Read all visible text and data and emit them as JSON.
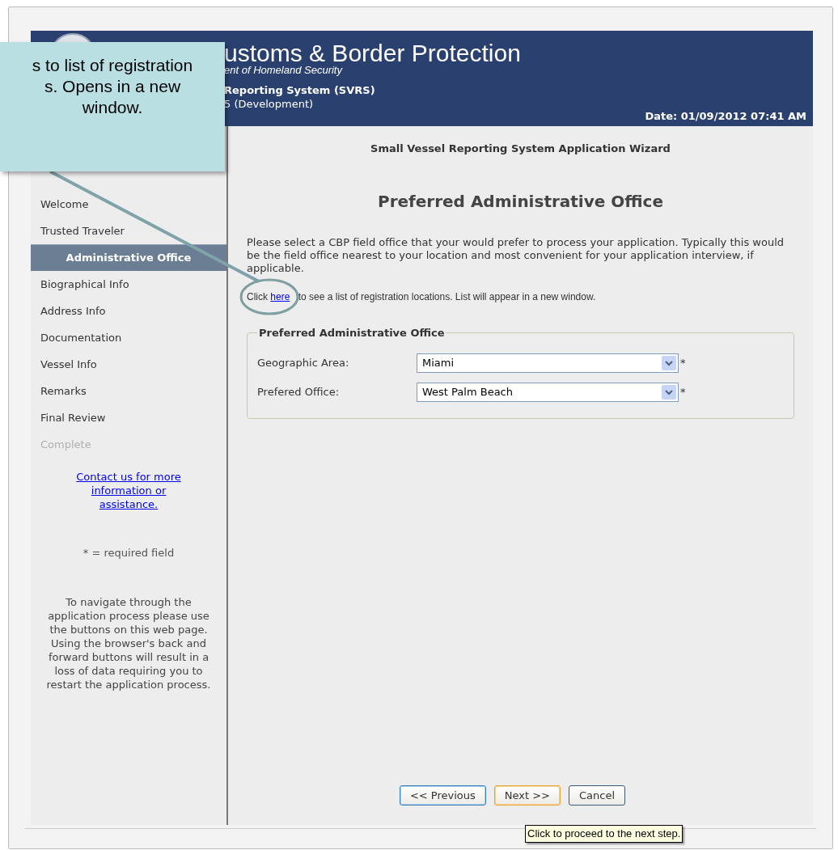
{
  "header": {
    "title": "ustoms & Border Protection",
    "subtitle": "ent of Homeland Security",
    "system": "Reporting System (SVRS)",
    "version": "5 (Development)",
    "date": "Date: 01/09/2012 07:41 AM"
  },
  "callout": {
    "lines": [
      "s to list of registration",
      "s. Opens in a new",
      "window."
    ]
  },
  "sidebar": {
    "steps": [
      {
        "label": "Welcome",
        "selected": false,
        "disabled": false
      },
      {
        "label": "Trusted Traveler",
        "selected": false,
        "disabled": false
      },
      {
        "label": "Administrative Office",
        "selected": true,
        "disabled": false
      },
      {
        "label": "Biographical Info",
        "selected": false,
        "disabled": false
      },
      {
        "label": "Address Info",
        "selected": false,
        "disabled": false
      },
      {
        "label": "Documentation",
        "selected": false,
        "disabled": false
      },
      {
        "label": "Vessel Info",
        "selected": false,
        "disabled": false
      },
      {
        "label": "Remarks",
        "selected": false,
        "disabled": false
      },
      {
        "label": "Final Review",
        "selected": false,
        "disabled": false
      },
      {
        "label": "Complete",
        "selected": false,
        "disabled": true
      }
    ],
    "contact_link": "Contact us for more information or assistance.",
    "required_note": "* = required field",
    "navigation_note": "To navigate through the application process please use the buttons on this web page. Using the browser's back and forward buttons will result in a loss of data requiring you to restart the application process."
  },
  "main": {
    "wizard_title": "Small Vessel Reporting System Application Wizard",
    "heading": "Preferred Administrative Office",
    "intro": "Please select a CBP field office that your would prefer to process your application. Typically this would be the field office nearest to your location and most convenient for your application interview, if applicable.",
    "link_sentence": {
      "before": "Click",
      "link": "here",
      "after": "to see a list of registration locations. List will appear in a new window."
    },
    "fieldset": {
      "legend": "Preferred Administrative Office",
      "fields": [
        {
          "label": "Geographic Area:",
          "value": "Miami",
          "suffix": "*"
        },
        {
          "label": "Prefered Office:",
          "value": "West Palm Beach",
          "suffix": "*"
        }
      ]
    },
    "buttons": [
      {
        "label": "<< Previous",
        "kind": "focused"
      },
      {
        "label": "Next >>",
        "kind": "hover"
      },
      {
        "label": "Cancel",
        "kind": "normal"
      }
    ]
  },
  "tooltip": "Click to proceed to the next step."
}
